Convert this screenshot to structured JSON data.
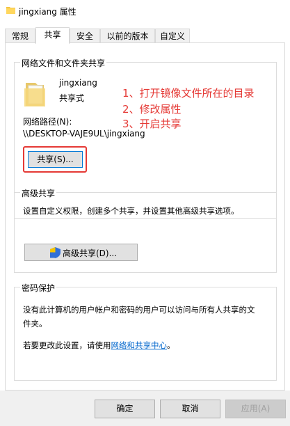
{
  "window": {
    "title": "jingxiang 属性"
  },
  "tabs": [
    "常规",
    "共享",
    "安全",
    "以前的版本",
    "自定义"
  ],
  "network_share": {
    "legend": "网络文件和文件夹共享",
    "folder_name": "jingxiang",
    "folder_status": "共享式",
    "path_label": "网络路径(N):",
    "path_value": "\\\\DESKTOP-VAJE9UL\\jingxiang",
    "share_button": "共享(S)..."
  },
  "annotations": [
    "1、打开镜像文件所在的目录",
    "2、修改属性",
    "3、开启共享"
  ],
  "advanced_share": {
    "legend": "高级共享",
    "description": "设置自定义权限，创建多个共享，并设置其他高级共享选项。",
    "button": "高级共享(D)..."
  },
  "password": {
    "legend": "密码保护",
    "line1": "没有此计算机的用户帐户和密码的用户可以访问与所有人共享的文",
    "line2": "件夹。",
    "change_text": "若要更改此设置，请使用",
    "link": "网络和共享中心",
    "suffix": "。"
  },
  "buttons": {
    "ok": "确定",
    "cancel": "取消",
    "apply": "应用(A)"
  },
  "colors": {
    "annotation": "#e53935",
    "link": "#0066cc"
  }
}
